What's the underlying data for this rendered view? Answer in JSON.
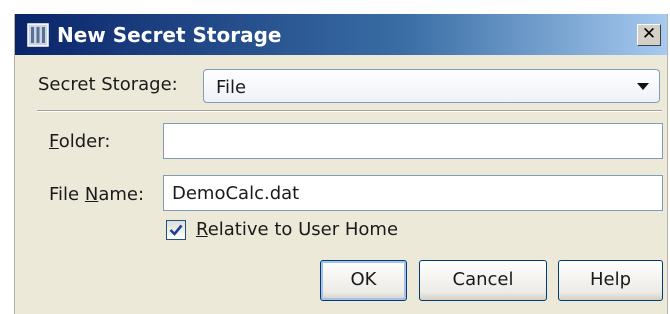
{
  "window": {
    "title": "New Secret Storage",
    "close_glyph": "✕"
  },
  "form": {
    "storage_label": "Secret Storage:",
    "storage_value": "File",
    "folder_label": "Folder:",
    "folder_mnemonic": "F",
    "folder_rest": "older:",
    "folder_value": "",
    "filename_label": "File Name:",
    "filename_pre": "File ",
    "filename_mnemonic": "N",
    "filename_rest": "ame:",
    "filename_value": "DemoCalc.dat",
    "relative_label": "Relative to User Home",
    "relative_mnemonic": "R",
    "relative_rest": "elative to User Home",
    "relative_checked": true
  },
  "buttons": {
    "ok": "OK",
    "cancel": "Cancel",
    "help": "Help"
  },
  "icons": {
    "title": "safe-storage-icon",
    "close": "close-icon",
    "dropdown": "chevron-down-icon",
    "check": "checkmark-icon"
  },
  "colors": {
    "titlebar_start": "#0a246a",
    "titlebar_end": "#a6caf0",
    "dialog_bg": "#ece9d8",
    "field_border": "#7f9db9",
    "check_color": "#21a121"
  }
}
